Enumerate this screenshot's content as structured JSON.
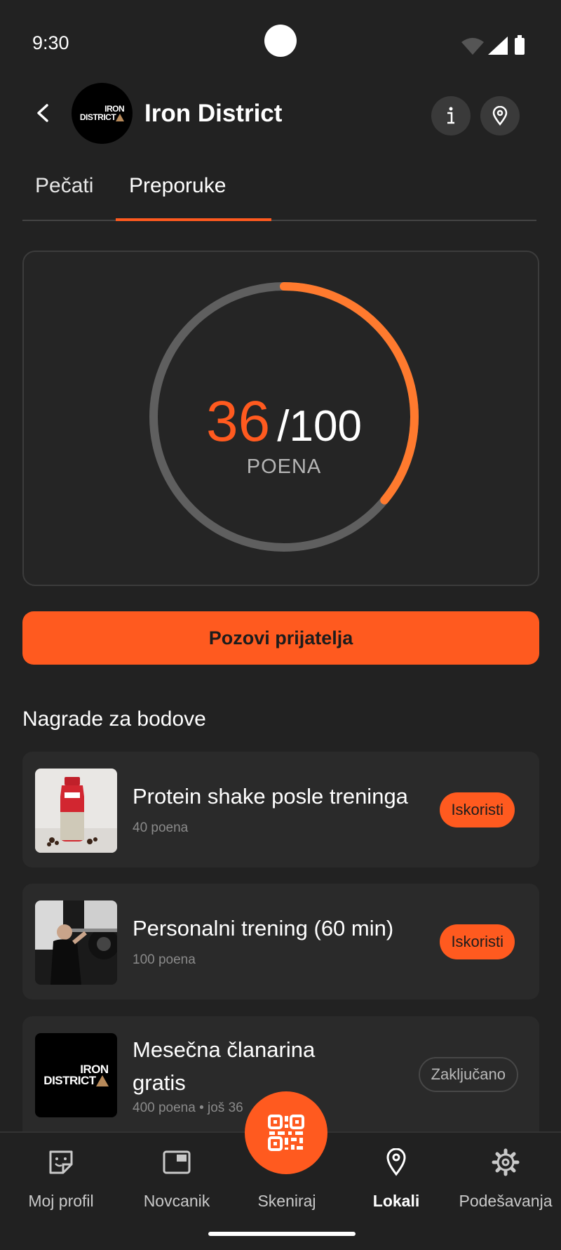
{
  "status_bar": {
    "time": "9:30"
  },
  "header": {
    "title": "Iron District",
    "logo_text_line1": "IRON",
    "logo_text_line2": "DISTRICT"
  },
  "tabs": [
    {
      "label": "Pečati",
      "active": false
    },
    {
      "label": "Preporuke",
      "active": true
    }
  ],
  "points": {
    "current": "36",
    "total": "/100",
    "label": "POENA",
    "progress_fraction": 0.36,
    "colors": {
      "progress": "#ff7a2e",
      "track": "#5f5f5f"
    }
  },
  "invite_button": {
    "label": "Pozovi prijatelja"
  },
  "rewards_section": {
    "title": "Nagrade za bodove",
    "items": [
      {
        "name": "Protein shake posle treninga",
        "cost": "40 poena",
        "action": "Iskoristi",
        "thumb": "protein-shake-photo"
      },
      {
        "name": "Personalni trening (60 min)",
        "cost": "100 poena",
        "action": "Iskoristi",
        "thumb": "trainer-photo"
      },
      {
        "name_line1": "Mesečna članarina",
        "name_line2": "gratis",
        "cost": "400 poena • još 36",
        "action": "Zaključano",
        "thumb": "iron-district-logo"
      }
    ]
  },
  "bottom_nav": {
    "items": [
      {
        "label": "Moj profil",
        "icon": "profile-icon"
      },
      {
        "label": "Novcanik",
        "icon": "wallet-icon"
      },
      {
        "label": "Skeniraj",
        "icon": "qr-code-icon"
      },
      {
        "label": "Lokali",
        "icon": "location-pin-icon",
        "active": true
      },
      {
        "label": "Podešavanja",
        "icon": "gear-icon"
      }
    ]
  },
  "colors": {
    "accent": "#ff5a1f",
    "background": "#222222",
    "card": "#2a2a2a"
  }
}
